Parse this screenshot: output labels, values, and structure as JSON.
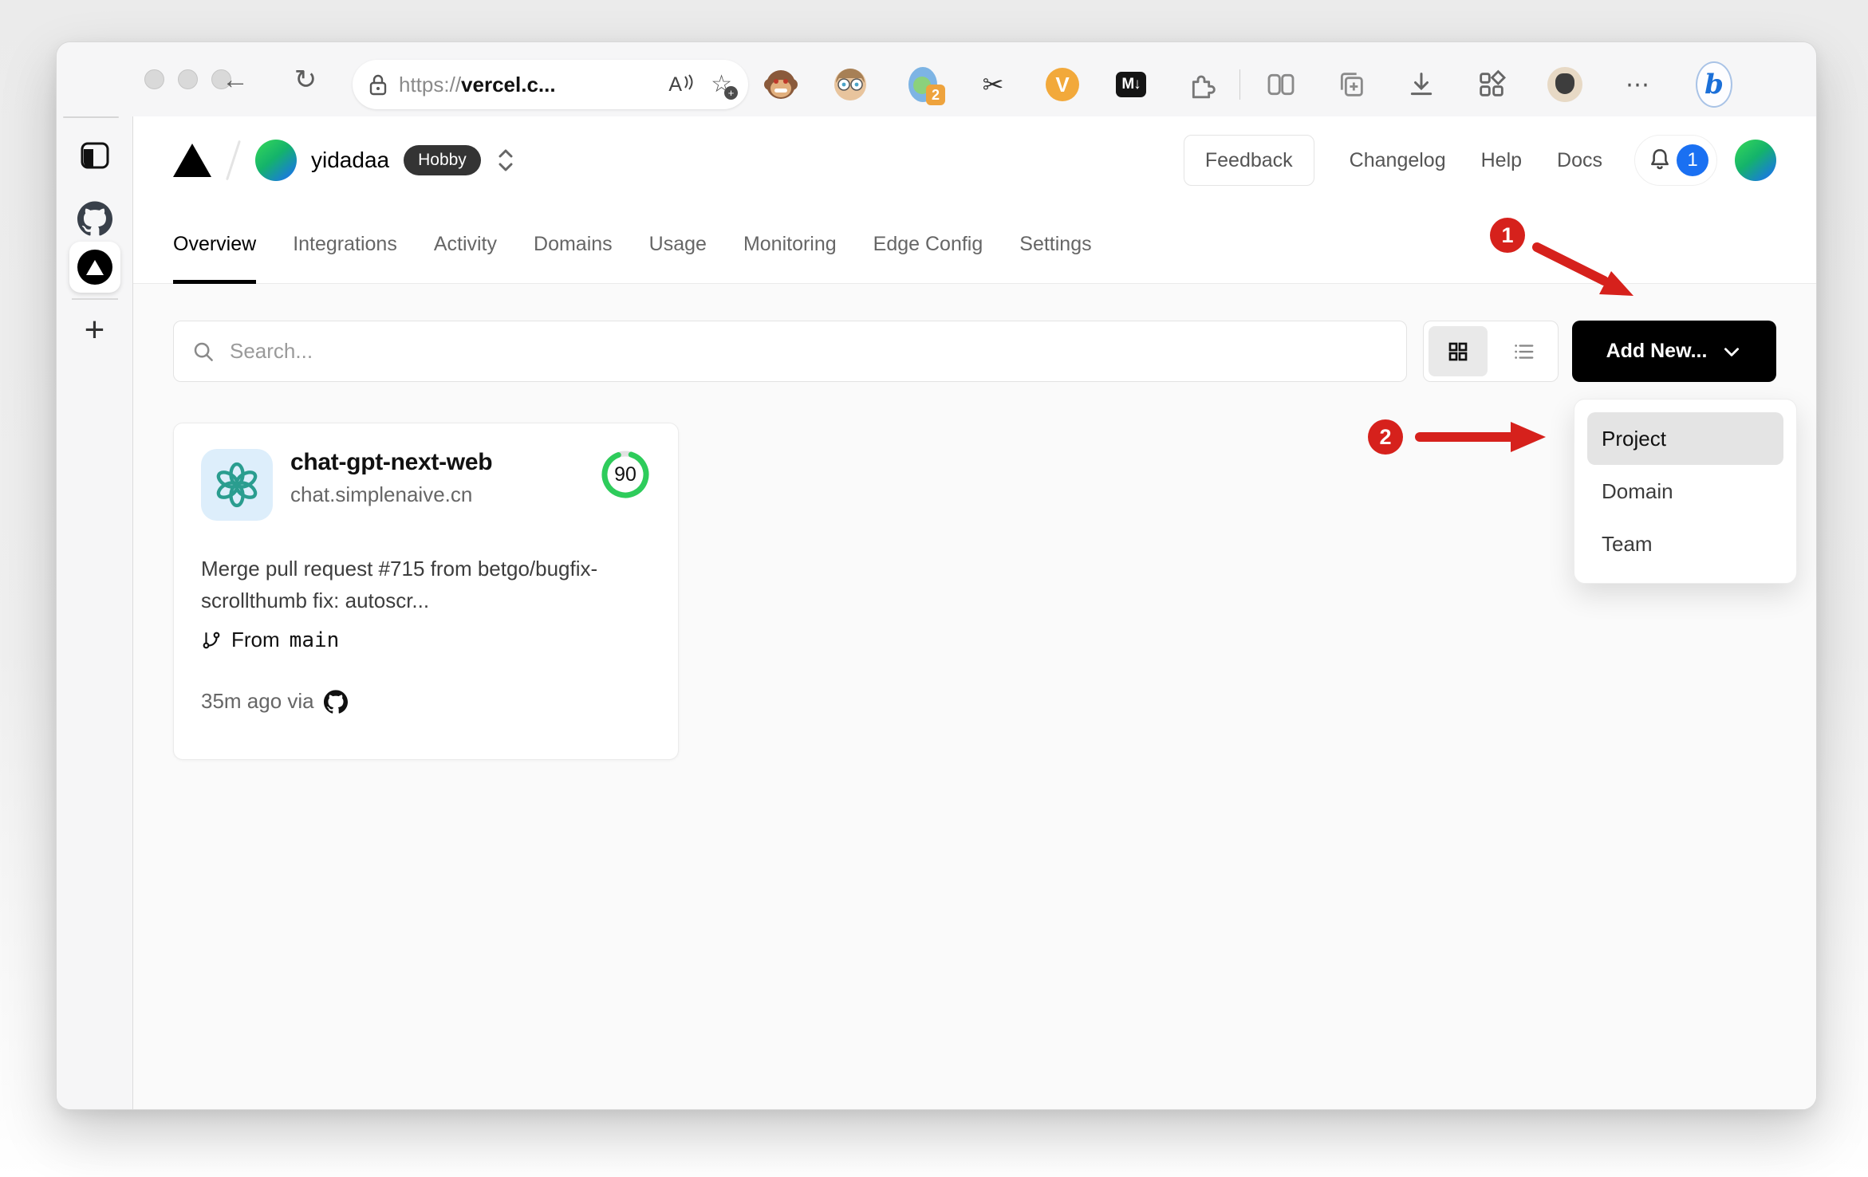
{
  "browser": {
    "url_prefix": "https://",
    "url_domain": "vercel.c...",
    "readaloud_label": "A",
    "star_plus": "+",
    "md_ext_label": "M↓",
    "v_ext_label": "V",
    "sync_ext_badge": "2",
    "scissors_glyph": "✂",
    "star_glyph": "☆",
    "back_glyph": "←",
    "refresh_glyph": "↻",
    "more_glyph": "⋯",
    "bing_label": "b"
  },
  "sidebar": {
    "new_tab_label": "+"
  },
  "header": {
    "team_name": "yidadaa",
    "plan_badge": "Hobby",
    "nav": {
      "feedback": "Feedback",
      "changelog": "Changelog",
      "help": "Help",
      "docs": "Docs"
    },
    "notification_count": "1",
    "notification_badge_color": "#1a70f2"
  },
  "tabs": [
    {
      "label": "Overview"
    },
    {
      "label": "Integrations"
    },
    {
      "label": "Activity"
    },
    {
      "label": "Domains"
    },
    {
      "label": "Usage"
    },
    {
      "label": "Monitoring"
    },
    {
      "label": "Edge Config"
    },
    {
      "label": "Settings"
    }
  ],
  "toolbar": {
    "search_placeholder": "Search...",
    "add_new_label": "Add New..."
  },
  "dropdown": {
    "items": [
      {
        "label": "Project"
      },
      {
        "label": "Domain"
      },
      {
        "label": "Team"
      }
    ]
  },
  "project_card": {
    "name": "chat-gpt-next-web",
    "domain": "chat.simplenaive.cn",
    "score": "90",
    "ring_color": "#2ecc5b",
    "commit_message": "Merge pull request #715 from betgo/bugfix-scrollthumb fix: autoscr...",
    "branch_prefix": "From",
    "branch": "main",
    "deployed": "35m ago via"
  },
  "annotations": {
    "step1": "1",
    "step2": "2",
    "color": "#d6211c"
  }
}
